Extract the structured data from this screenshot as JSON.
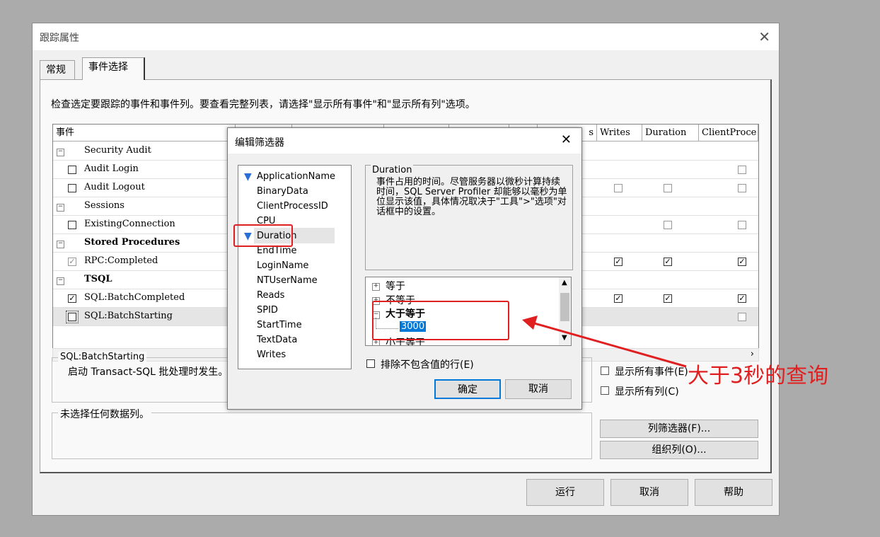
{
  "window": {
    "title": "跟踪属性",
    "tabs": [
      "常规",
      "事件选择"
    ],
    "instructions": "检查选定要跟踪的事件和事件列。要查看完整列表，请选择\"显示所有事件\"和\"显示所有列\"选项。"
  },
  "grid": {
    "columns": [
      "事件",
      "s",
      "Writes",
      "Duration",
      "ClientProce"
    ],
    "rows": [
      {
        "label": "Security Audit",
        "type": "category"
      },
      {
        "label": "Audit Login",
        "type": "event",
        "checked": false
      },
      {
        "label": "Audit Logout",
        "type": "event",
        "checked": false
      },
      {
        "label": "Sessions",
        "type": "category"
      },
      {
        "label": "ExistingConnection",
        "type": "event",
        "checked": false
      },
      {
        "label": "Stored Procedures",
        "type": "category"
      },
      {
        "label": "RPC:Completed",
        "type": "event",
        "checked": true
      },
      {
        "label": "TSQL",
        "type": "category"
      },
      {
        "label": "SQL:BatchCompleted",
        "type": "event",
        "checked": true
      },
      {
        "label": "SQL:BatchStarting",
        "type": "event",
        "checked": false
      }
    ]
  },
  "event_info": {
    "title": "SQL:BatchStarting",
    "text": "启动 Transact-SQL 批处理时发生。"
  },
  "column_info": {
    "title": "未选择任何数据列。"
  },
  "options": {
    "show_all_events": "显示所有事件(E)",
    "show_all_columns": "显示所有列(C)",
    "column_filter": "列筛选器(F)...",
    "organize_columns": "组织列(O)..."
  },
  "footer": {
    "run": "运行",
    "cancel": "取消",
    "help": "帮助"
  },
  "filter_dialog": {
    "title": "编辑筛选器",
    "columns": [
      "ApplicationName",
      "BinaryData",
      "ClientProcessID",
      "CPU",
      "Duration",
      "EndTime",
      "LoginName",
      "NTUserName",
      "Reads",
      "SPID",
      "StartTime",
      "TextData",
      "Writes"
    ],
    "selected_column": "Duration",
    "description_title": "Duration",
    "description": "事件占用的时间。尽管服务器以微秒计算持续时间，SQL Server Profiler 却能够以毫秒为单位显示该值，具体情况取决于\"工具\">\"选项\"对话框中的设置。",
    "tree": {
      "equal": "等于",
      "not_equal": "不等于",
      "gte": "大于等于",
      "value": "3000",
      "lte": "小于等于"
    },
    "exclude_null": "排除不包含值的行(E)",
    "ok": "确定",
    "cancel": "取消"
  },
  "annotation": {
    "text": "大于3秒的查询",
    "color": "#e02020"
  }
}
